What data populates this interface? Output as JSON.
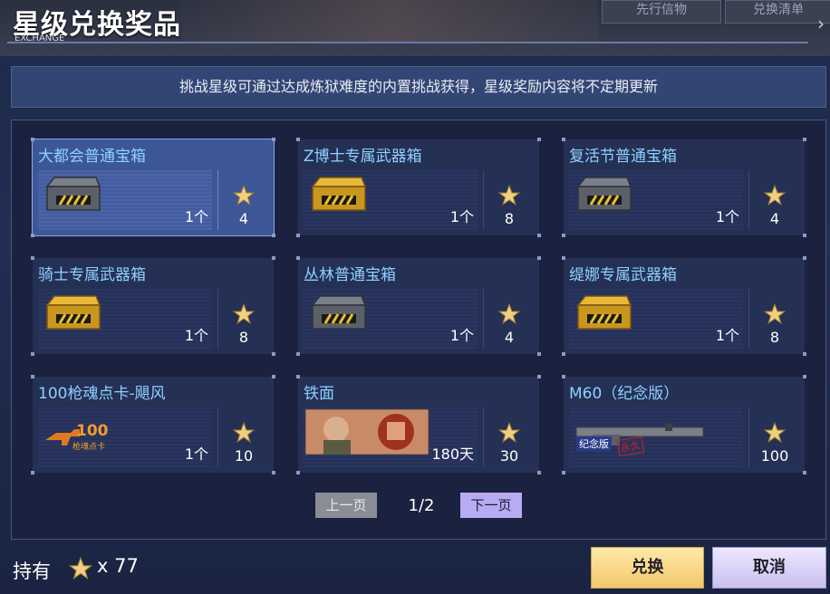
{
  "header": {
    "title": "星级兑换奖品",
    "subtitle": "EXCHANGE",
    "tabs": [
      "先行信物",
      "兑换清单"
    ]
  },
  "notice": "挑战星级可通过达成炼狱难度的内置挑战获得，星级奖励内容将不定期更新",
  "items": [
    {
      "name": "大都会普通宝箱",
      "qty": "1个",
      "cost": "4",
      "icon": "silver-chest-icon",
      "selected": true
    },
    {
      "name": "Z博士专属武器箱",
      "qty": "1个",
      "cost": "8",
      "icon": "gold-chest-icon"
    },
    {
      "name": "复活节普通宝箱",
      "qty": "1个",
      "cost": "4",
      "icon": "silver-chest-icon"
    },
    {
      "name": "骑士专属武器箱",
      "qty": "1个",
      "cost": "8",
      "icon": "gold-chest-icon"
    },
    {
      "name": "丛林普通宝箱",
      "qty": "1个",
      "cost": "4",
      "icon": "silver-chest-icon"
    },
    {
      "name": "缇娜专属武器箱",
      "qty": "1个",
      "cost": "8",
      "icon": "gold-chest-icon"
    },
    {
      "name": "100枪魂点卡-飓风",
      "qty": "1个",
      "cost": "10",
      "icon": "gun-soul-card-icon",
      "icon_text": "100",
      "icon_subtext": "枪魂点卡"
    },
    {
      "name": "铁面",
      "qty": "180天",
      "cost": "30",
      "icon": "iron-face-character-icon"
    },
    {
      "name": "M60（纪念版）",
      "qty": "",
      "cost": "100",
      "icon": "m60-rifle-icon",
      "icon_tags": [
        "纪念版",
        "永久"
      ]
    }
  ],
  "pager": {
    "prev_label": "上一页",
    "next_label": "下一页",
    "page": "1/2"
  },
  "footer": {
    "hold_label": "持有",
    "hold_count": "x 77",
    "exchange_label": "兑换",
    "cancel_label": "取消"
  },
  "colors": {
    "accent_blue": "#8ed0ff",
    "gold_button": "#f2c86a",
    "lavender_button": "#c9c0ef",
    "star": "#f0d080"
  }
}
